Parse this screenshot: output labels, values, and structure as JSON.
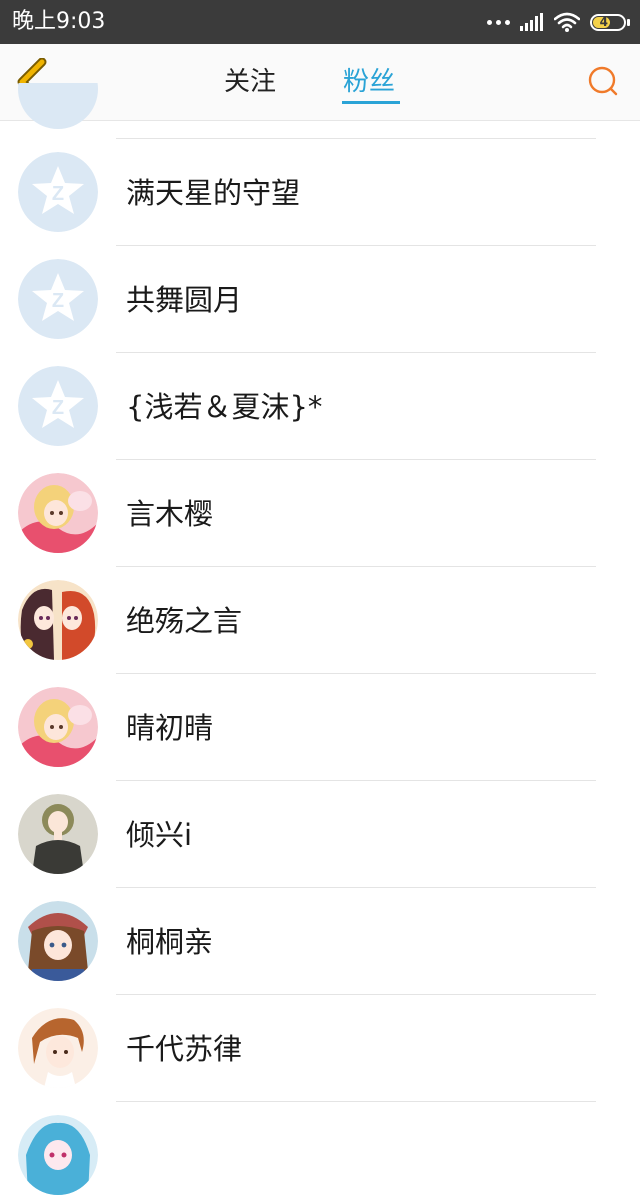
{
  "status_bar": {
    "time": "晚上9:03",
    "battery": "41"
  },
  "header": {
    "tabs": [
      {
        "label": "关注",
        "active": false
      },
      {
        "label": "粉丝",
        "active": true
      }
    ]
  },
  "fans": [
    {
      "name": "满天星的守望",
      "avatar": "default-qq"
    },
    {
      "name": "共舞圆月",
      "avatar": "default-qq"
    },
    {
      "name": "{浅若＆夏沫}*",
      "avatar": "default-qq"
    },
    {
      "name": "言木樱",
      "avatar": "anime-pink"
    },
    {
      "name": "绝殇之言",
      "avatar": "anime-two-girls"
    },
    {
      "name": "晴初晴",
      "avatar": "anime-pink"
    },
    {
      "name": "倾兴i",
      "avatar": "anime-green-dress"
    },
    {
      "name": "桐桐亲",
      "avatar": "anime-brown-hat"
    },
    {
      "name": "千代苏律",
      "avatar": "anime-orange-hair"
    },
    {
      "name": "",
      "avatar": "anime-blue-hair"
    }
  ],
  "colors": {
    "accent": "#2aa3d6",
    "back_icon": "#f0b400",
    "search_icon": "#f07a2a",
    "status_bar": "#3b3b3b"
  }
}
